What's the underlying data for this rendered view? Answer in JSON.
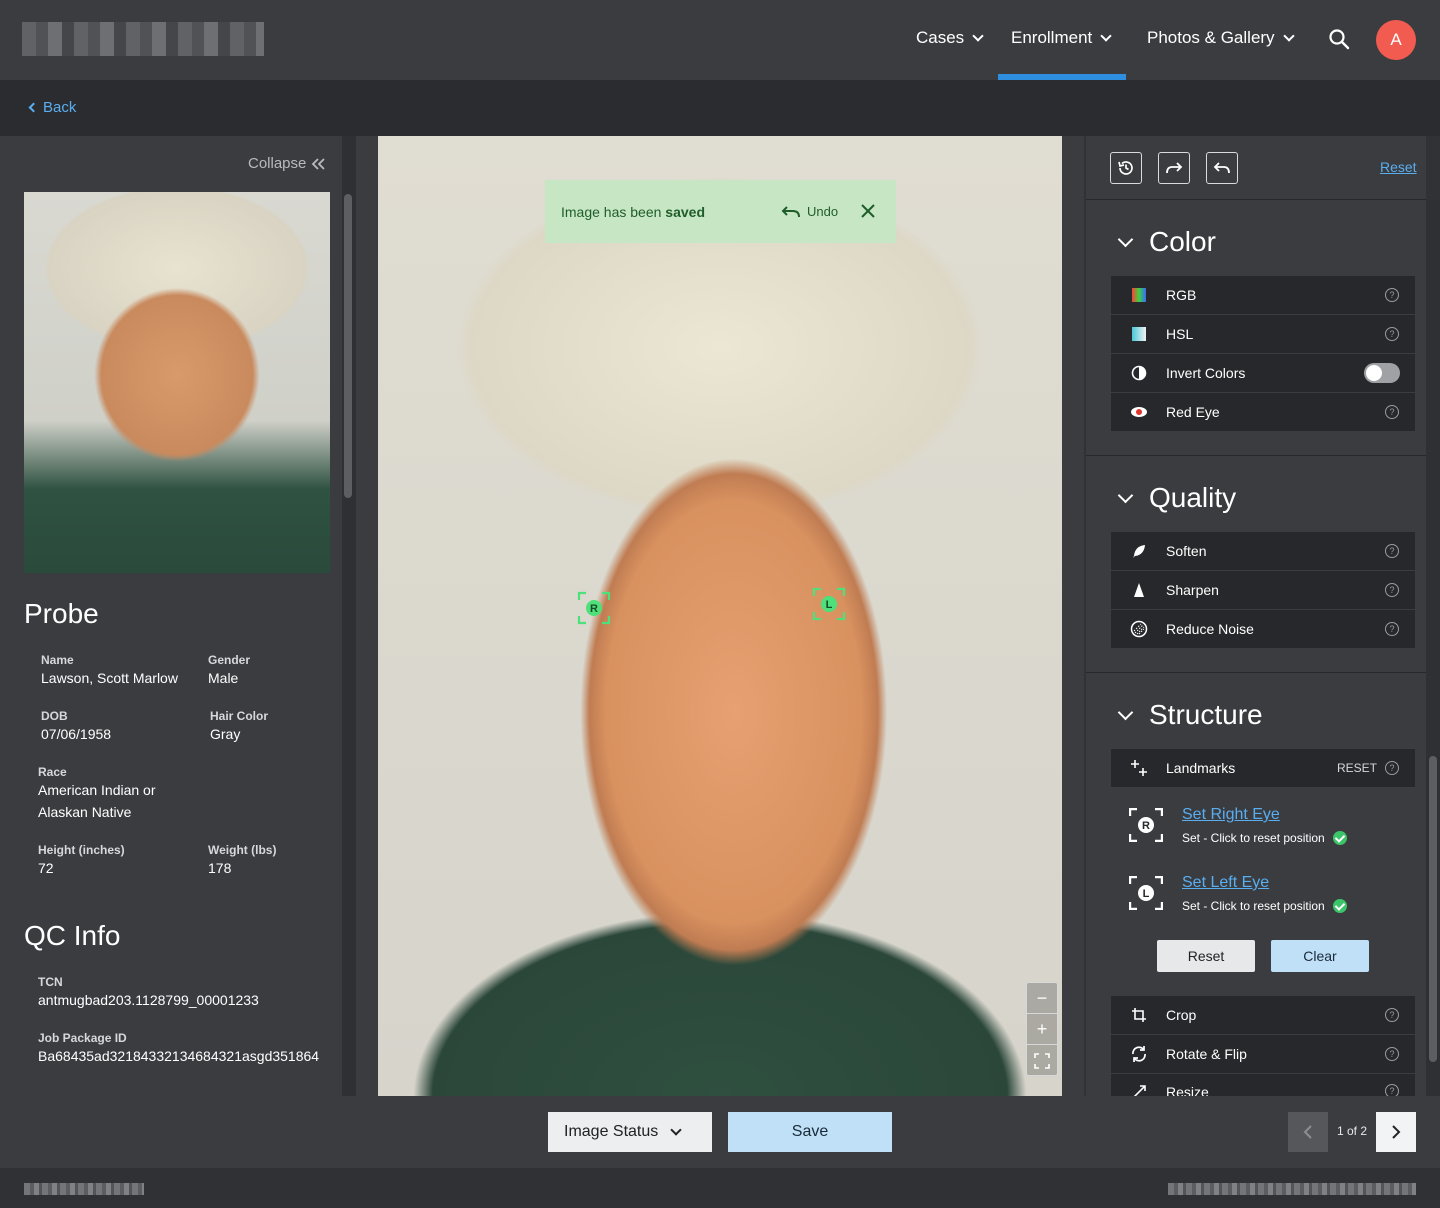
{
  "nav": {
    "items": [
      {
        "label": "Cases"
      },
      {
        "label": "Enrollment"
      },
      {
        "label": "Photos & Gallery"
      }
    ],
    "avatar_initial": "A",
    "accent": "#2e8fe0",
    "avatar_color": "#f25c50"
  },
  "subnav": {
    "back_label": "Back"
  },
  "left": {
    "collapse_label": "Collapse",
    "probe_title": "Probe",
    "fields": {
      "name_label": "Name",
      "name": "Lawson, Scott Marlow",
      "gender_label": "Gender",
      "gender": "Male",
      "dob_label": "DOB",
      "dob": "07/06/1958",
      "hair_label": "Hair Color",
      "hair": "Gray",
      "race_label": "Race",
      "race": "American Indian or Alaskan Native",
      "height_label": "Height (inches)",
      "height": "72",
      "weight_label": "Weight (lbs)",
      "weight": "178"
    },
    "qc_title": "QC Info",
    "qc": {
      "tcn_label": "TCN",
      "tcn": "antmugbad203.1128799_00001233",
      "job_label": "Job Package ID",
      "job": "Ba68435ad32184332134684321asgd351864"
    }
  },
  "toast": {
    "message_prefix": "Image has been ",
    "message_bold": "saved",
    "undo_label": "Undo"
  },
  "markers": {
    "right_letter": "R",
    "left_letter": "L"
  },
  "right": {
    "reset_label": "Reset",
    "color_title": "Color",
    "color_rows": [
      "RGB",
      "HSL",
      "Invert Colors",
      "Red Eye"
    ],
    "invert_colors_on": false,
    "quality_title": "Quality",
    "quality_rows": [
      "Soften",
      "Sharpen",
      "Reduce Noise"
    ],
    "structure_title": "Structure",
    "landmarks_label": "Landmarks",
    "landmarks_reset": "RESET",
    "right_eye_link": "Set Right Eye",
    "left_eye_link": "Set Left Eye",
    "set_status": "Set - Click to reset position",
    "reset_btn": "Reset",
    "clear_btn": "Clear",
    "structure_rows": [
      "Crop",
      "Rotate & Flip",
      "Resize"
    ]
  },
  "bottom": {
    "status_label": "Image Status",
    "save_label": "Save",
    "page_text": "1 of 2"
  }
}
